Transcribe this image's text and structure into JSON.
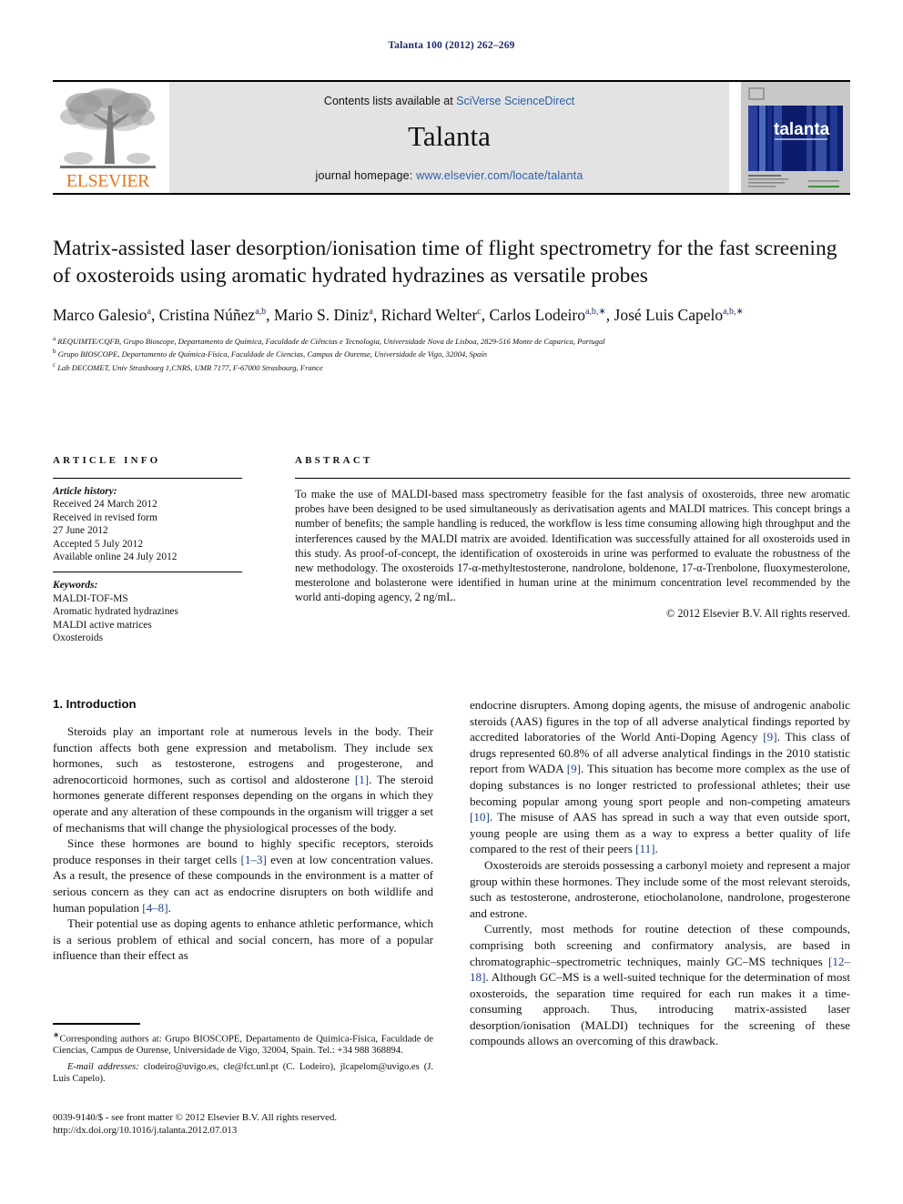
{
  "running_head": "Talanta 100 (2012) 262–269",
  "masthead": {
    "contents_prefix": "Contents lists available at ",
    "contents_link": "SciVerse ScienceDirect",
    "journal_name": "Talanta",
    "homepage_prefix": "journal homepage: ",
    "homepage_link": "www.elsevier.com/locate/talanta",
    "publisher_logo_text": "ELSEVIER",
    "cover_title": "talanta",
    "cover_subtitle": "the international journal of pure and applied analytical chemistry"
  },
  "article": {
    "title": "Matrix-assisted laser desorption/ionisation time of flight spectrometry for the fast screening of oxosteroids using aromatic hydrated hydrazines as versatile probes",
    "authors": [
      {
        "name": "Marco Galesio",
        "sup": "a",
        "star": false
      },
      {
        "name": "Cristina Núñez",
        "sup": "a,b",
        "star": false
      },
      {
        "name": "Mario S. Diniz",
        "sup": "a",
        "star": false
      },
      {
        "name": "Richard Welter",
        "sup": "c",
        "star": false
      },
      {
        "name": "Carlos Lodeiro",
        "sup": "a,b",
        "star": true
      },
      {
        "name": "José Luis Capelo",
        "sup": "a,b",
        "star": true
      }
    ],
    "affiliations": [
      {
        "label": "a",
        "text": "REQUIMTE/CQFB, Grupo Bioscope, Departamento de Química, Faculdade de Ciências e Tecnologia, Universidade Nova de Lisboa, 2829-516 Monte de Caparica, Portugal"
      },
      {
        "label": "b",
        "text": "Grupo BIOSCOPE, Departamento de Química-Física, Faculdade de Ciencias, Campus de Ourense, Universidade de Vigo, 32004, Spaín"
      },
      {
        "label": "c",
        "text": "Lab DECOMET, Univ Strasbourg 1,CNRS, UMR 7177, F-67000 Strasbourg, France"
      }
    ]
  },
  "article_info": {
    "heading": "ARTICLE INFO",
    "history_heading": "Article history:",
    "history_lines": [
      "Received 24 March 2012",
      "Received in revised form",
      "27 June 2012",
      "Accepted 5 July 2012",
      "Available online 24 July 2012"
    ],
    "keywords_heading": "Keywords:",
    "keywords": [
      "MALDI-TOF-MS",
      "Aromatic hydrated hydrazines",
      "MALDI active matrices",
      "Oxosteroids"
    ]
  },
  "abstract": {
    "heading": "ABSTRACT",
    "text": "To make the use of MALDI-based mass spectrometry feasible for the fast analysis of oxosteroids, three new aromatic probes have been designed to be used simultaneously as derivatisation agents and MALDI matrices. This concept brings a number of benefits; the sample handling is reduced, the workflow is less time consuming allowing high throughput and the interferences caused by the MALDI matrix are avoided. Identification was successfully attained for all oxosteroids used in this study. As proof-of-concept, the identification of oxosteroids in urine was performed to evaluate the robustness of the new methodology. The oxosteroids 17-α-methyltestosterone, nandrolone, boldenone, 17-α-Trenbolone, fluoxymesterolone, mesterolone and bolasterone were identified in human urine at the minimum concentration level recommended by the world anti-doping agency, 2 ng/mL.",
    "copyright": "© 2012 Elsevier B.V. All rights reserved."
  },
  "body": {
    "section_title": "1. Introduction",
    "left_paragraphs": [
      {
        "parts": [
          {
            "t": "Steroids play an important role at numerous levels in the body. Their function affects both gene expression and metabolism. They include sex hormones, such as testosterone, estrogens and progesterone, and adrenocorticoid hormones, such as cortisol and aldosterone "
          },
          {
            "t": "[1]",
            "ref": true
          },
          {
            "t": ". The steroid hormones generate different responses depending on the organs in which they operate and any alteration of these compounds in the organism will trigger a set of mechanisms that will change the physiological processes of the body."
          }
        ]
      },
      {
        "parts": [
          {
            "t": "Since these hormones are bound to highly specific receptors, steroids produce responses in their target cells "
          },
          {
            "t": "[1–3]",
            "ref": true
          },
          {
            "t": " even at low concentration values. As a result, the presence of these compounds in the environment is a matter of serious concern as they can act as endocrine disrupters on both wildlife and human population "
          },
          {
            "t": "[4–8]",
            "ref": true
          },
          {
            "t": "."
          }
        ]
      },
      {
        "parts": [
          {
            "t": "Their potential use as doping agents to enhance athletic performance, which is a serious problem of ethical and social concern, has more of a popular influence than their effect as"
          }
        ]
      }
    ],
    "right_paragraphs": [
      {
        "no_indent": true,
        "parts": [
          {
            "t": "endocrine disrupters. Among doping agents, the misuse of androgenic anabolic steroids (AAS) figures in the top of all adverse analytical findings reported by accredited laboratories of the World Anti-Doping Agency "
          },
          {
            "t": "[9]",
            "ref": true
          },
          {
            "t": ". This class of drugs represented 60.8% of all adverse analytical findings in the 2010 statistic report from WADA "
          },
          {
            "t": "[9]",
            "ref": true
          },
          {
            "t": ". This situation has become more complex as the use of doping substances is no longer restricted to professional athletes; their use becoming popular among young sport people and non-competing amateurs "
          },
          {
            "t": "[10]",
            "ref": true
          },
          {
            "t": ". The misuse of AAS has spread in such a way that even outside sport, young people are using them as a way to express a better quality of life compared to the rest of their peers "
          },
          {
            "t": "[11]",
            "ref": true
          },
          {
            "t": "."
          }
        ]
      },
      {
        "parts": [
          {
            "t": "Oxosteroids are steroids possessing a carbonyl moiety and represent a major group within these hormones. They include some of the most relevant steroids, such as testosterone, androsterone, etiocholanolone, nandrolone, progesterone and estrone."
          }
        ]
      },
      {
        "parts": [
          {
            "t": "Currently, most methods for routine detection of these compounds, comprising both screening and confirmatory analysis, are based in chromatographic–spectrometric techniques, mainly GC–MS techniques "
          },
          {
            "t": "[12–18]",
            "ref": true
          },
          {
            "t": ". Although GC–MS is a well-suited technique for the determination of most oxosteroids, the separation time required for each run makes it a time-consuming approach. Thus, introducing matrix-assisted laser desorption/ionisation (MALDI) techniques for the screening of these compounds allows an overcoming of this drawback."
          }
        ]
      }
    ]
  },
  "footnote": {
    "corresponding": "Corresponding authors at: Grupo BIOSCOPE, Departamento de Química-Física, Faculdade de Ciencias, Campus de Ourense, Universidade de Vigo, 32004, Spain. Tel.: +34 988 368894.",
    "email_label": "E-mail addresses:",
    "email_text": " clodeiro@uvigo.es, cle@fct.unl.pt (C. Lodeiro), jlcapelom@uvigo.es (J. Luis Capelo)."
  },
  "issn": {
    "line1": "0039-9140/$ - see front matter © 2012 Elsevier B.V. All rights reserved.",
    "line2": "http://dx.doi.org/10.1016/j.talanta.2012.07.013"
  },
  "colors": {
    "link": "#2b5fa8",
    "ref": "#1b3d8f",
    "running_head": "#1b2a6b",
    "elsevier_orange": "#E87722",
    "masthead_bg": "#e3e3e3"
  }
}
